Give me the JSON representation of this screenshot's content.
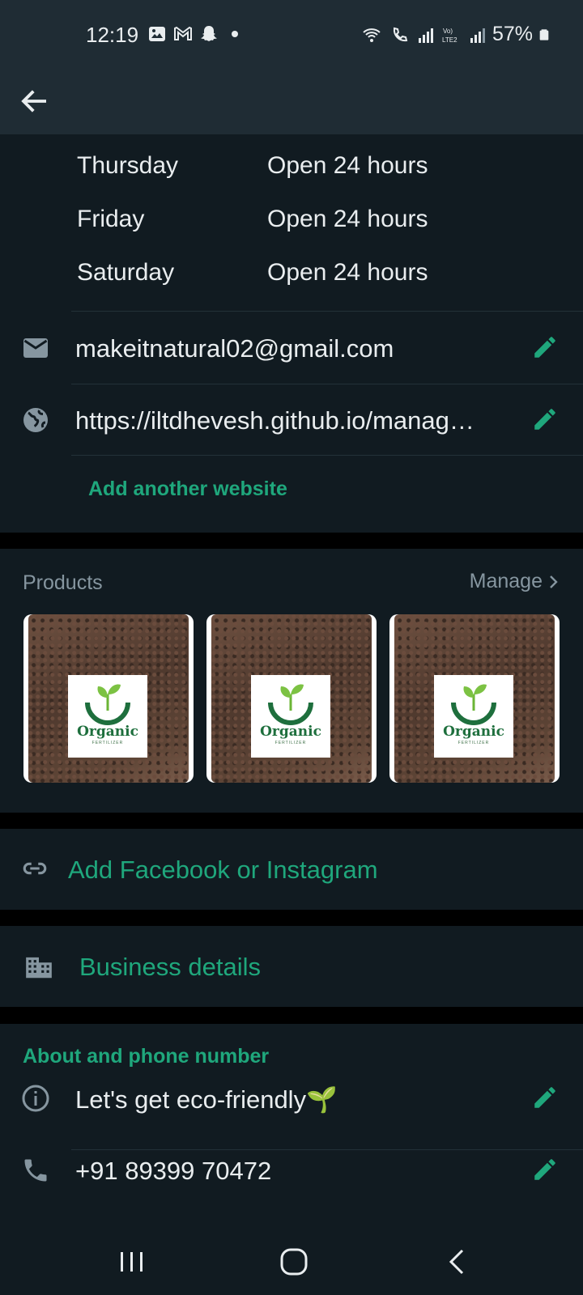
{
  "status_bar": {
    "time": "12:19",
    "battery": "57%"
  },
  "app_bar": {
    "back_icon": "arrow-left-icon"
  },
  "hours": [
    {
      "day": "Thursday",
      "value": "Open 24 hours"
    },
    {
      "day": "Friday",
      "value": "Open 24 hours"
    },
    {
      "day": "Saturday",
      "value": "Open 24 hours"
    }
  ],
  "contact": {
    "email": "makeitnatural02@gmail.com",
    "website": "https://iltdhevesh.github.io/manag…",
    "add_website": "Add another website"
  },
  "products": {
    "title": "Products",
    "manage": "Manage",
    "items": [
      {
        "brand": "Organic",
        "sub": "FERTILIZER"
      },
      {
        "brand": "Organic",
        "sub": "FERTILIZER"
      },
      {
        "brand": "Organic",
        "sub": "FERTILIZER"
      }
    ]
  },
  "social": {
    "label": "Add Facebook or Instagram"
  },
  "business": {
    "label": "Business details"
  },
  "about": {
    "section_title": "About and phone number",
    "about_text": "Let's get eco-friendly🌱",
    "phone": "+91 89399 70472"
  },
  "colors": {
    "accent": "#1fa77c",
    "background": "#111b21",
    "header": "#1f2c34",
    "muted": "#8696a0"
  }
}
